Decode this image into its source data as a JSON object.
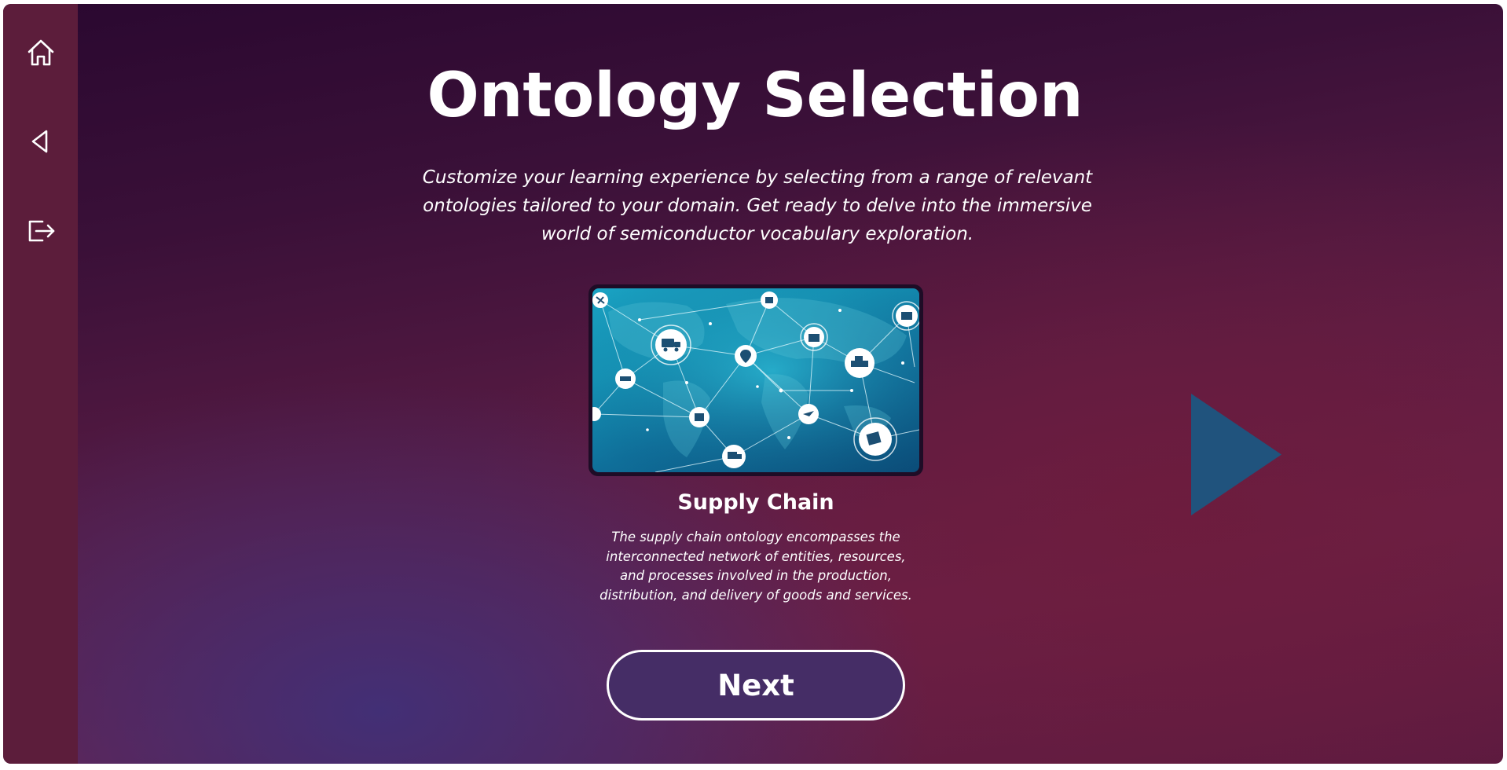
{
  "sidebar": {
    "items": [
      {
        "icon": "home-icon"
      },
      {
        "icon": "back-arrow-icon"
      },
      {
        "icon": "logout-icon"
      }
    ]
  },
  "main": {
    "title": "Ontology Selection",
    "subtitle": "Customize your learning experience by selecting from a range of relevant ontologies tailored to your domain. Get ready to delve into the immersive world of semiconductor vocabulary exploration.",
    "card": {
      "title": "Supply Chain",
      "description": "The supply chain ontology encompasses the interconnected network of entities, resources, and processes involved in the production, distribution, and delivery of goods and services."
    },
    "next_button_label": "Next",
    "next_arrow_icon": "play-triangle-icon"
  },
  "colors": {
    "sidebar": "#5c1d3b",
    "next_arrow": "#20537d",
    "next_button_fill": "#452d66",
    "text": "#ffffff"
  }
}
